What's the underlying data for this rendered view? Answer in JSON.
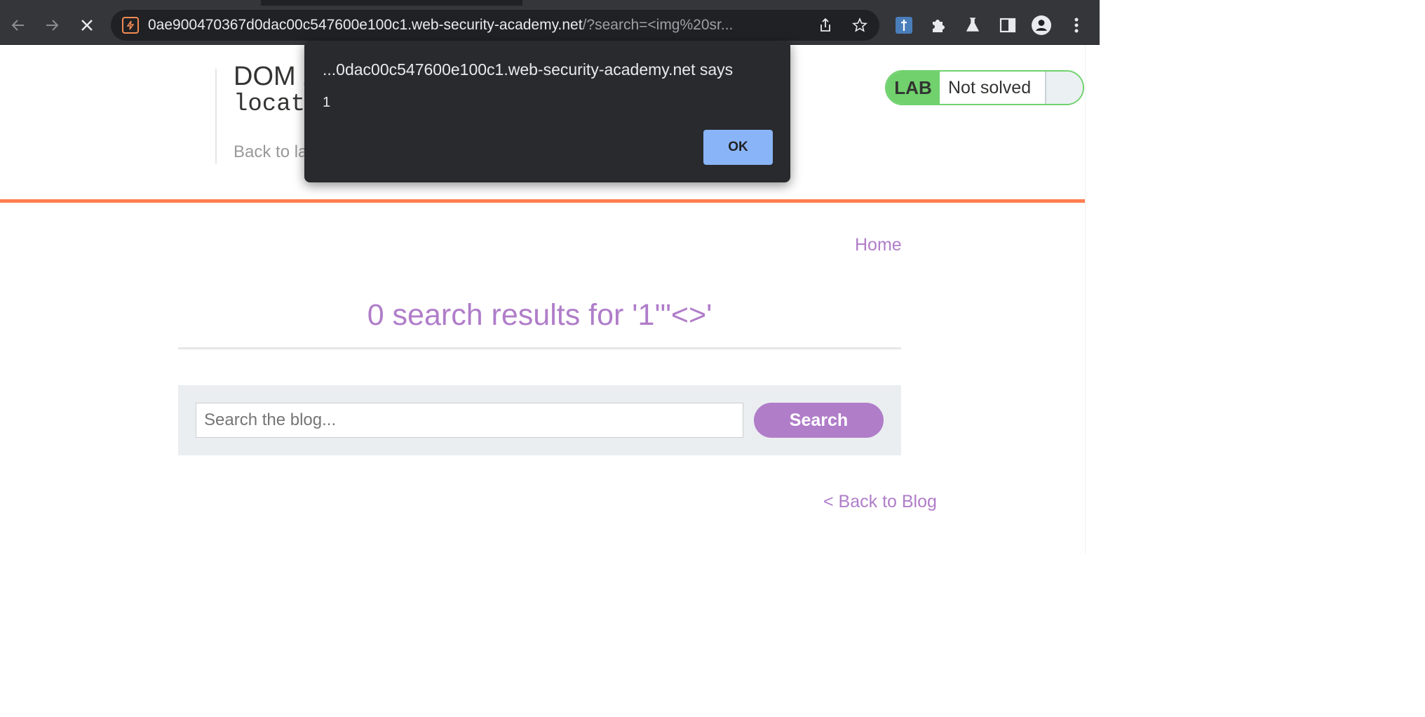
{
  "browser": {
    "url_host": "0ae900470367d0dac00c547600e100c1.web-security-academy.net",
    "url_path": "/?search=<img%20sr...",
    "icons": [
      "back-arrow-icon",
      "forward-arrow-icon",
      "stop-loading-icon",
      "site-favicon",
      "share-icon",
      "bookmark-star-icon",
      "extension-icon",
      "puzzle-icon",
      "lab-flask-icon",
      "side-panel-icon",
      "profile-avatar-icon",
      "menu-kebab-icon"
    ]
  },
  "header": {
    "title_line1": "DOM X",
    "title_line2": "locat",
    "back_to_lab": "Back to la"
  },
  "lab_status": {
    "badge": "LAB",
    "status": "Not solved",
    "badge_color": "#70d16d"
  },
  "nav": {
    "home": "Home"
  },
  "search": {
    "results_heading": "0 search results for '1'\"<>'",
    "placeholder": "Search the blog...",
    "button": "Search"
  },
  "footer": {
    "back_to_blog": "< Back to Blog"
  },
  "alert": {
    "title": "...0dac00c547600e100c1.web-security-academy.net says",
    "message": "1",
    "ok": "OK",
    "ok_color": "#8ab4f8"
  },
  "accent_color": "#b07dc9"
}
